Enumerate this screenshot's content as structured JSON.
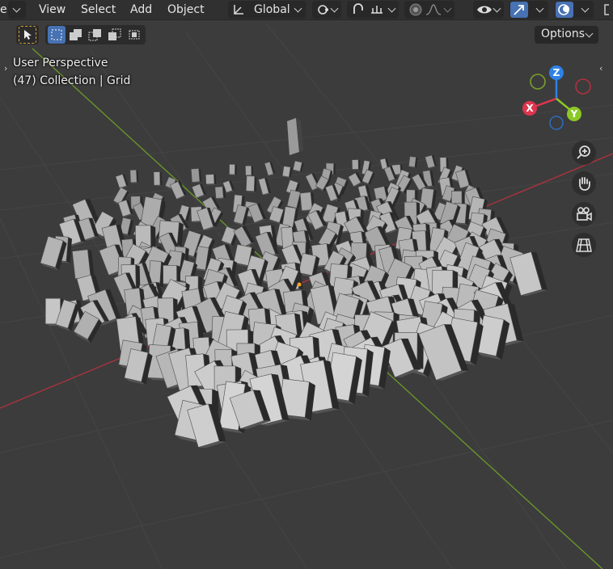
{
  "header": {
    "menus": [
      "View",
      "Select",
      "Add",
      "Object"
    ],
    "transform_orientation": "Global"
  },
  "toolbar": {
    "options_label": "Options"
  },
  "viewport": {
    "perspective_label": "User Perspective",
    "collection_label": "(47) Collection | Grid"
  },
  "gizmo": {
    "z": "Z",
    "x": "X",
    "y": "Y",
    "colors": {
      "x": "#e0354f",
      "y": "#8bc926",
      "z": "#2e82e6",
      "bg": "#3c3c3c"
    }
  },
  "icons": [
    "select-arrow-icon",
    "box-select-icon",
    "mode-new-icon",
    "mode-extend-icon",
    "mode-subtract-icon",
    "mode-intersect-icon",
    "pivot-icon",
    "snap-icon",
    "proportional-edit-icon",
    "visibility-icon",
    "gizmo-icon",
    "overlay-icon",
    "zoom-icon",
    "hand-pan-icon",
    "camera-icon",
    "grid-ortho-icon"
  ]
}
